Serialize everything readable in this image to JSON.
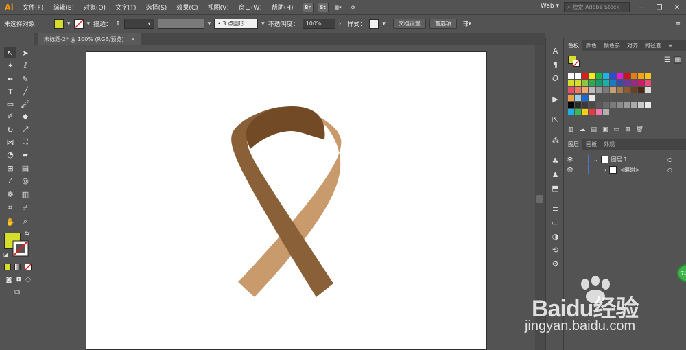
{
  "app": {
    "logo": "Ai",
    "workspace": "Web",
    "search_placeholder": "搜索 Adobe Stock"
  },
  "menu": [
    "文件(F)",
    "编辑(E)",
    "对象(O)",
    "文字(T)",
    "选择(S)",
    "效果(C)",
    "视图(V)",
    "窗口(W)",
    "帮助(H)"
  ],
  "menu_icons": {
    "bridge": "Br",
    "stock": "St"
  },
  "control": {
    "selection": "未选择对象",
    "stroke_label": "描边：",
    "brush_value": "3 点圆形",
    "opacity_label": "不透明度：",
    "opacity_value": "100%",
    "style_label": "样式：",
    "doc_setup": "文档设置",
    "preferences": "首选项"
  },
  "document": {
    "tab_title": "未标题-2* @ 100% (RGB/预览)",
    "close": "×"
  },
  "colors": {
    "fill": "#d4de2b",
    "ribbon_dark": "#8a6038",
    "ribbon_light": "#c99b6c",
    "ribbon_inner": "#724a25"
  },
  "panels": {
    "top_tabs": [
      "色板",
      "颜色",
      "颜色参",
      "对齐",
      "路径查"
    ],
    "bottom_tabs": [
      "图层",
      "画板",
      "外观"
    ],
    "layers": [
      {
        "name": "图层 1"
      },
      {
        "name": "<编组>"
      }
    ]
  },
  "watermark": {
    "brand": "Baidu经验",
    "url": "jingyan.baidu.com"
  },
  "badge": "74"
}
